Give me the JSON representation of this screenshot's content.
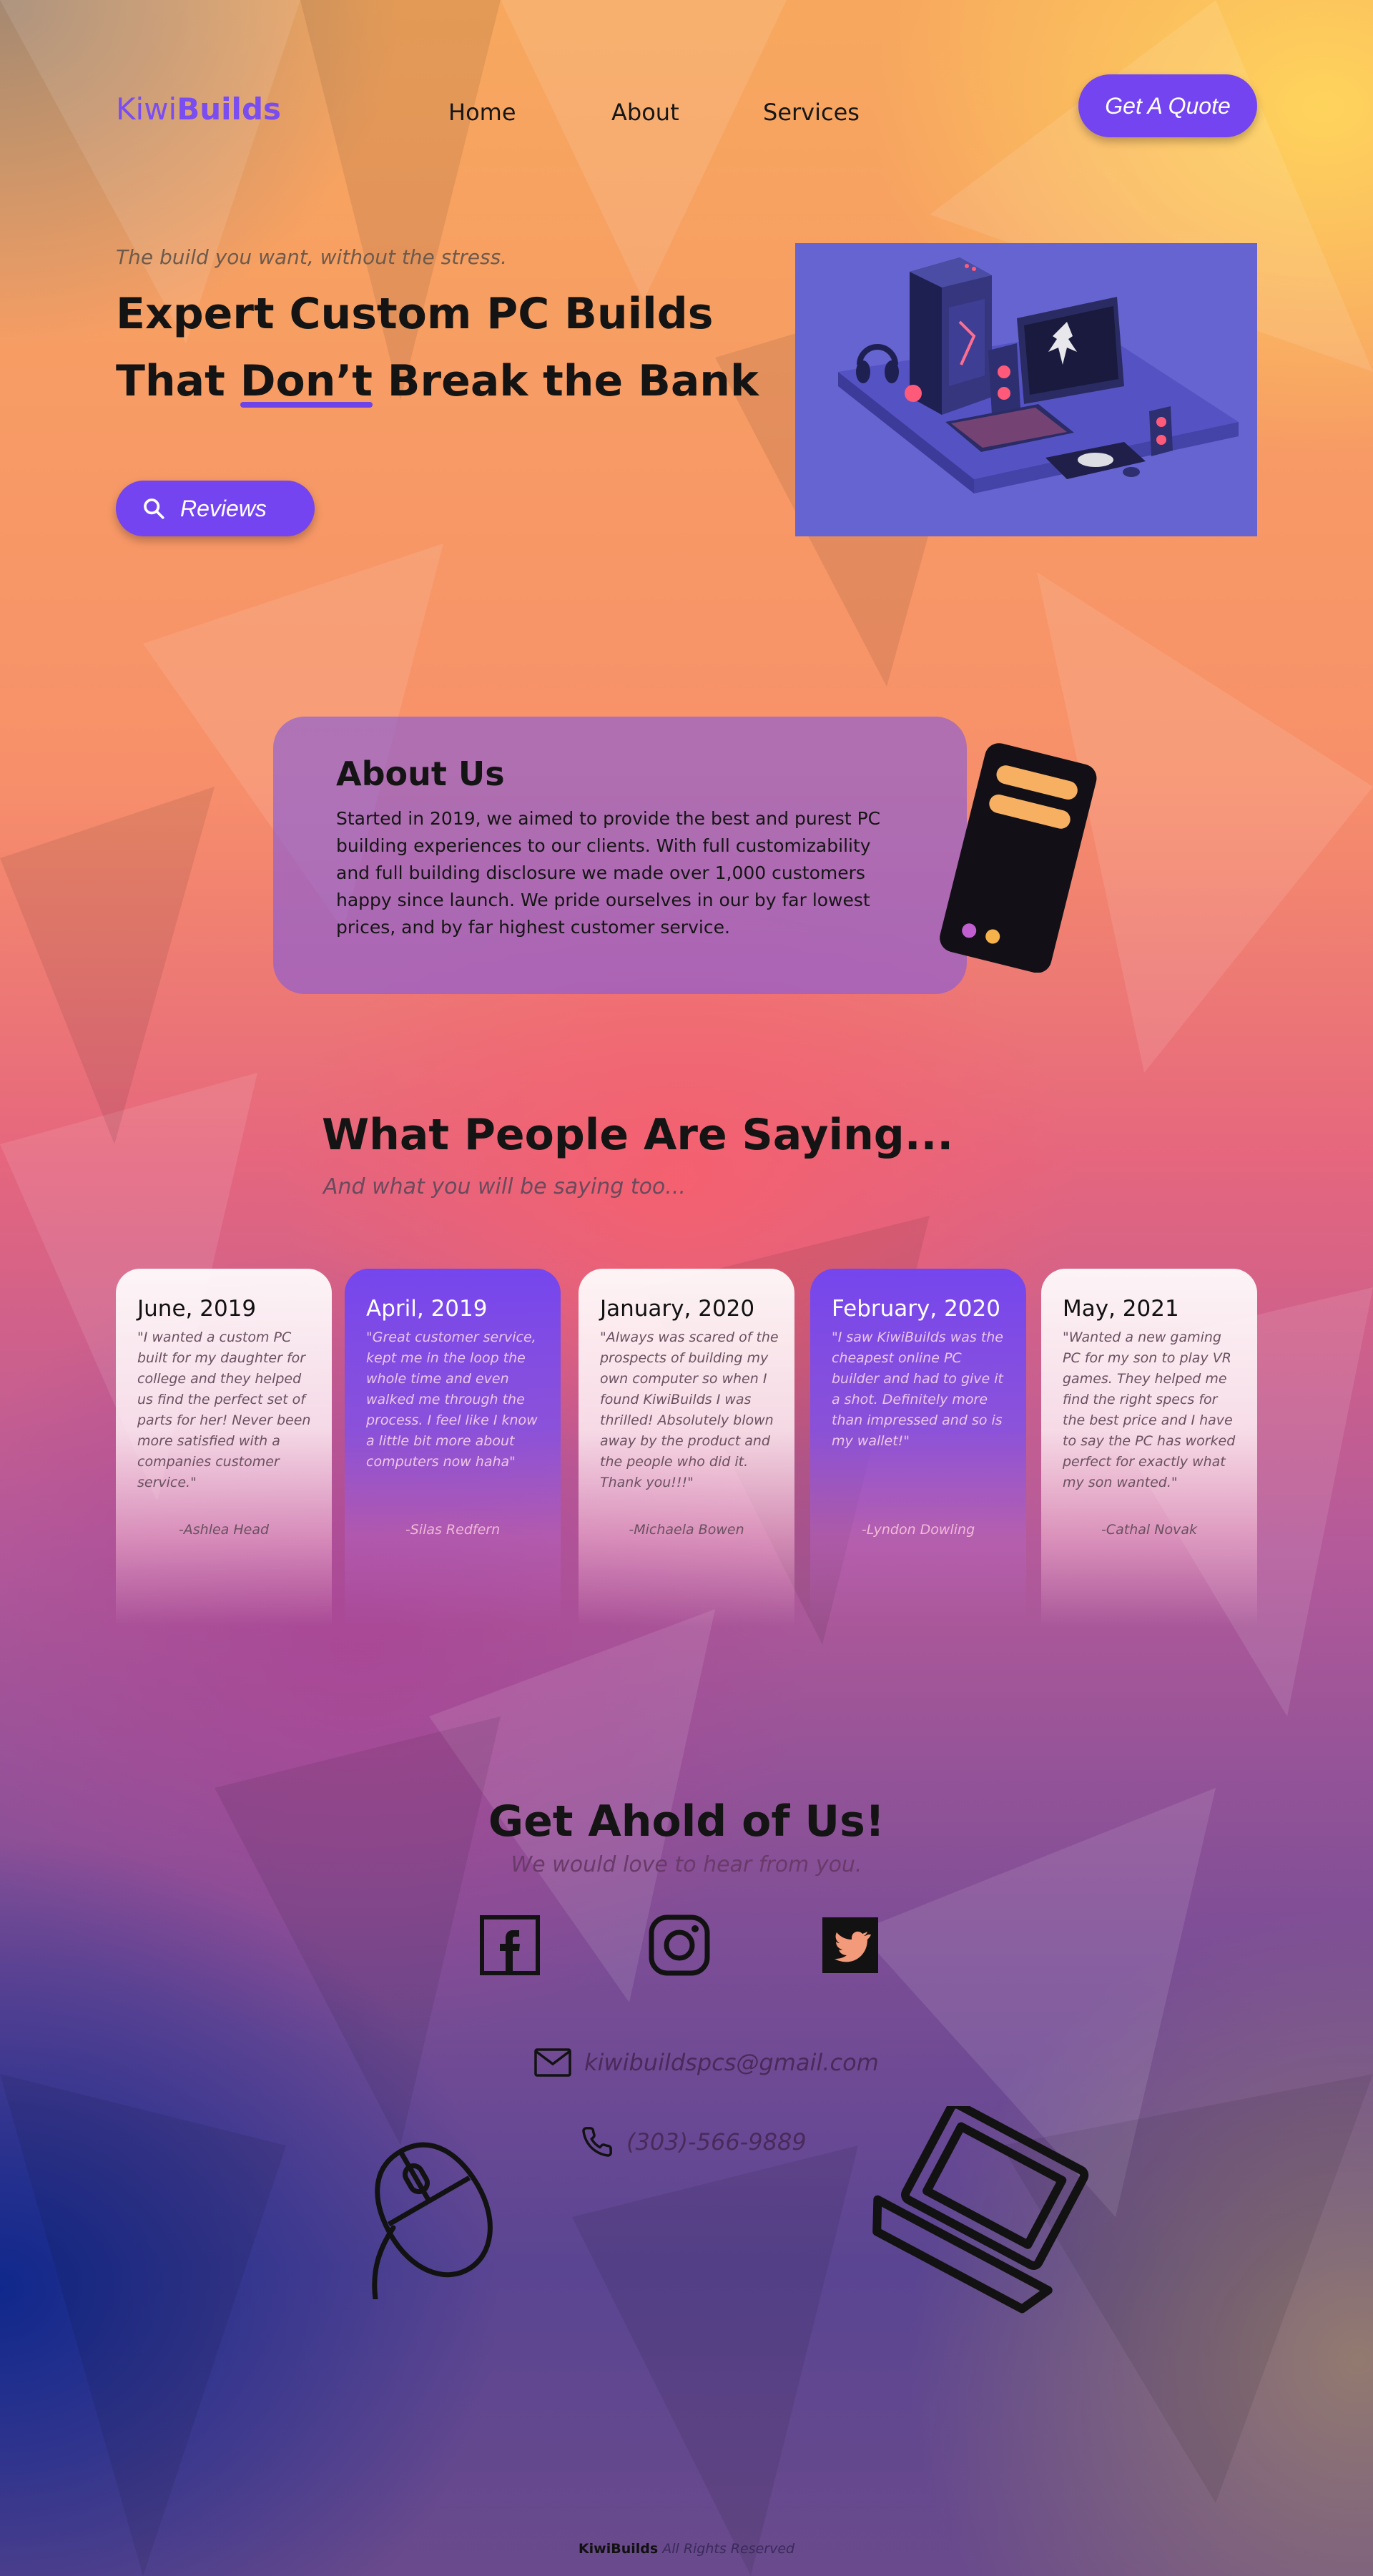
{
  "header": {
    "logo_light": "Kiwi",
    "logo_bold": "Builds",
    "nav": [
      "Home",
      "About",
      "Services"
    ],
    "quote_button": "Get A Quote"
  },
  "hero": {
    "tagline": "The build you want, without the stress.",
    "title_part1": "Expert Custom PC Builds That ",
    "title_underlined": "Don’t",
    "title_part2": " Break the Bank",
    "reviews_button": "Reviews"
  },
  "about": {
    "title": "About Us",
    "text": "Started in 2019, we aimed to provide the best and purest PC building experiences to our clients. With full customizability and full building disclosure we made over 1,000 customers happy since launch. We pride ourselves in our by far lowest prices, and by far highest customer service."
  },
  "testimonials": {
    "title": "What People Are Saying...",
    "subtitle": "And what you will be saying too...",
    "cards": [
      {
        "date": "June, 2019",
        "quote": "\"I wanted a custom PC built for my daughter for college and they helped us find the perfect set of parts for her! Never been more satisfied with a companies customer service.\"",
        "author": "-Ashlea Head"
      },
      {
        "date": "April, 2019",
        "quote": "\"Great customer service, kept me in the loop the whole time and even walked me through the process. I feel like I know a little bit more about computers now haha\"",
        "author": "-Silas Redfern"
      },
      {
        "date": "January, 2020",
        "quote": "\"Always was scared of the prospects of building my own computer so when I found KiwiBuilds I was thrilled! Absolutely blown away by the product and the people who did it. Thank you!!!\"",
        "author": "-Michaela Bowen"
      },
      {
        "date": "February, 2020",
        "quote": "\"I saw KiwiBuilds was the cheapest online PC builder and had to give it a shot. Definitely more than impressed and so is my wallet!\"",
        "author": "-Lyndon Dowling"
      },
      {
        "date": "May, 2021",
        "quote": "\"Wanted a new gaming PC for my son to play VR games. They helped me find the right specs for the best price and I have to say the PC has worked perfect for exactly what my son wanted.\"",
        "author": "-Cathal Novak"
      }
    ]
  },
  "contact": {
    "title": "Get Ahold of Us!",
    "subtitle": "We would love to hear from you.",
    "email": "kiwibuildspcs@gmail.com",
    "phone": "(303)-566-9889"
  },
  "footer": {
    "brand_light": "Kiwi",
    "brand_bold": "Builds",
    "rights": " All Rights Reserved"
  },
  "icons": {
    "search": "search-icon",
    "facebook": "facebook-icon",
    "instagram": "instagram-icon",
    "twitter": "twitter-icon",
    "email": "envelope-icon",
    "phone": "phone-icon",
    "mouse": "mouse-icon",
    "laptop": "laptop-icon",
    "computer_tower": "computer-tower-icon"
  },
  "colors": {
    "accent": "#7444f0",
    "text_dark": "#141414"
  }
}
